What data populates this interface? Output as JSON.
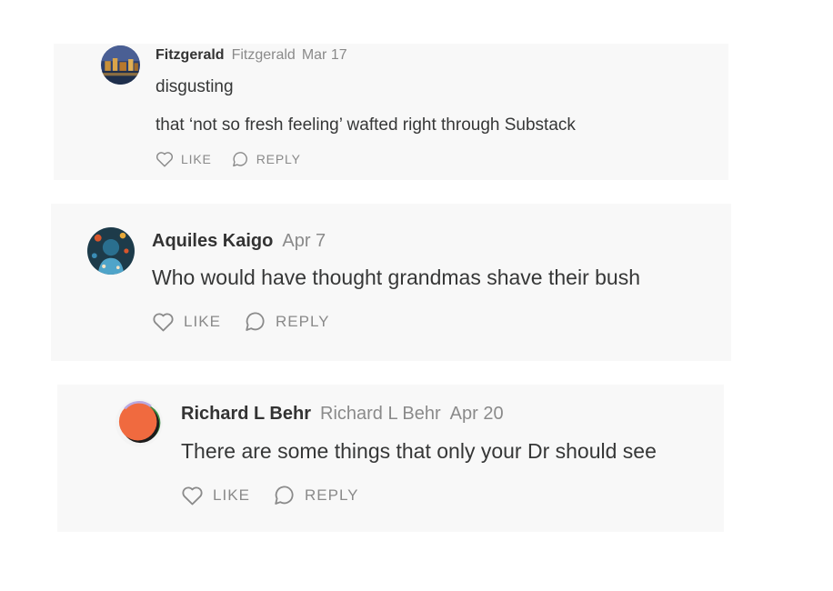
{
  "comments": [
    {
      "author": "Fitzgerald",
      "handle": "Fitzgerald",
      "date": "Mar 17",
      "lines": [
        "disgusting",
        "that ‘not so fresh feeling’ wafted right through Substack"
      ],
      "like_label": "LIKE",
      "reply_label": "REPLY",
      "avatar_icon": "city-night-photo-avatar"
    },
    {
      "author": "Aquiles Kaigo",
      "date": "Apr 7",
      "lines": [
        "Who would have thought grandmas shave their bush"
      ],
      "like_label": "LIKE",
      "reply_label": "REPLY",
      "avatar_icon": "illustrated-portrait-avatar"
    },
    {
      "author": "Richard L Behr",
      "handle": "Richard L Behr",
      "date": "Apr 20",
      "lines": [
        "There are some things that only your Dr should see"
      ],
      "like_label": "LIKE",
      "reply_label": "REPLY",
      "avatar_icon": "orange-circle-avatar"
    }
  ],
  "colors": {
    "card_background": "#f8f8f8",
    "text": "#363737",
    "muted": "#8a8a8a"
  }
}
